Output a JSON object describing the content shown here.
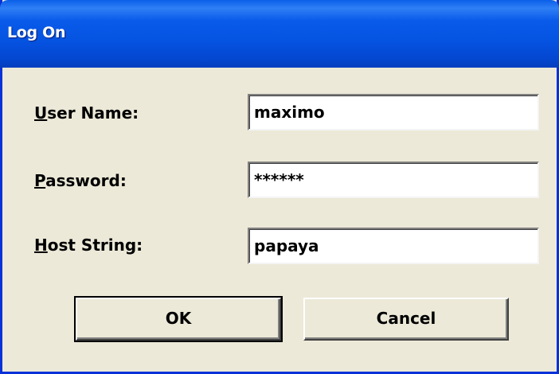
{
  "window": {
    "title": "Log On"
  },
  "form": {
    "user_name": {
      "label_accel": "U",
      "label_rest": "ser Name:",
      "value": "maximo"
    },
    "password": {
      "label_accel": "P",
      "label_rest": "assword:",
      "value": "******"
    },
    "host_string": {
      "label_accel": "H",
      "label_rest": "ost String:",
      "value": "papaya"
    }
  },
  "buttons": {
    "ok_label": "OK",
    "cancel_label": "Cancel"
  },
  "colors": {
    "titlebar": "#0553e1",
    "dialog_background": "#ece9d8"
  }
}
